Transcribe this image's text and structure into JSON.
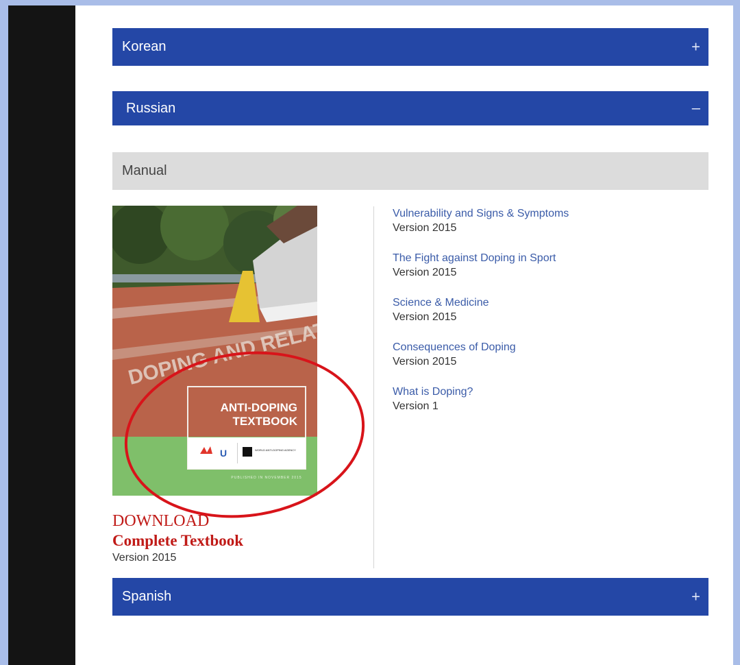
{
  "accordion": {
    "korean": {
      "label": "Korean",
      "toggle": "+"
    },
    "russian": {
      "label": "Russian",
      "toggle": "–"
    },
    "spanish": {
      "label": "Spanish",
      "toggle": "+"
    }
  },
  "manual": {
    "header": "Manual",
    "cover": {
      "title_line1": "ANTI-DOPING",
      "title_line2": "TEXTBOOK",
      "track_text": "DOPING AND RELATED ISSUES",
      "publisher_text": "WORLD ANTI-DOPING AGENCY",
      "published_line": "PUBLISHED IN NOVEMBER 2015"
    },
    "download": {
      "label": "DOWNLOAD",
      "subtitle": "Complete Textbook",
      "version": "Version 2015"
    },
    "documents": [
      {
        "title": "Vulnerability and Signs & Symptoms",
        "version": "Version 2015"
      },
      {
        "title": "The Fight against Doping in Sport",
        "version": "Version 2015"
      },
      {
        "title": "Science & Medicine",
        "version": "Version 2015"
      },
      {
        "title": "Consequences of Doping",
        "version": "Version 2015"
      },
      {
        "title": "What is Doping?",
        "version": "Version 1"
      }
    ]
  },
  "colors": {
    "accordion_blue": "#2447a6",
    "download_red": "#c01a17",
    "annotation_red": "#d8141a",
    "link_blue": "#3a5ba8"
  }
}
